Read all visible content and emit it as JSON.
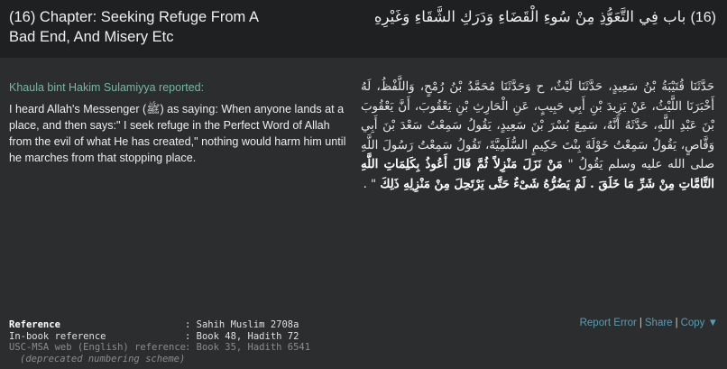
{
  "chapter": {
    "title_en": "(16)  Chapter: Seeking Refuge From A Bad End, And Misery Etc",
    "number_ar": "(16)",
    "title_ar": "باب فِي التَّعَوُّذِ مِنْ سُوءِ الْقَضَاءِ وَدَرَكِ الشَّقَاءِ وَغَيْرِهِ"
  },
  "hadith": {
    "narrator": "Khaula bint Hakim Sulamiyya reported:",
    "english": "I heard Allah's Messenger (ﷺ) as saying: When anyone lands at a place, and then says:\" I seek refuge in the Perfect Word of Allah from the evil of what He has created,\" nothing would harm him until he marches from that stopping place.",
    "arabic_isnad": "حَدَّثَنَا قُتَيْبَةُ بْنُ سَعِيدٍ، حَدَّثَنَا لَيْثٌ، ح وَحَدَّثَنَا مُحَمَّدُ بْنُ رُمْحٍ، وَاللَّفْظُ، لَهُ أَخْبَرَنَا اللَّيْثُ، عَنْ يَزِيدَ بْنِ أَبِي حَبِيبٍ، عَنِ الْحَارِثِ بْنِ يَعْقُوبَ، أَنَّ يَعْقُوبَ بْنَ عَبْدِ اللَّهِ، حَدَّثَهُ أَنَّهُ، سَمِعَ بُسْرَ بْنَ سَعِيدٍ، يَقُولُ سَمِعْتُ سَعْدَ بْنَ أَبِي وَقَّاصٍ، يَقُولُ سَمِعْتُ خَوْلَةَ بِنْتَ حَكِيمٍ السُّلَمِيَّةَ، تَقُولُ سَمِعْتُ رَسُولَ اللَّهِ صلى الله عليه وسلم يَقُولُ \"",
    "arabic_matn": "مَنْ نَزَلَ مَنْزِلاً ثُمَّ قَالَ أَعُوذُ بِكَلِمَاتِ اللَّهِ التَّامَّاتِ مِنْ شَرِّ مَا خَلَقَ . لَمْ يَضُرُّهُ شَىْءٌ حَتَّى يَرْتَحِلَ مِنْ مَنْزِلِهِ ذَلِكَ",
    "arabic_end": "\" ."
  },
  "references": [
    {
      "key": "Reference",
      "value": ": Sahih Muslim 2708a",
      "style": "bold"
    },
    {
      "key": "In-book reference",
      "value": ": Book 48, Hadith 72",
      "style": "plain"
    },
    {
      "key": "USC-MSA web (English) reference",
      "value": ": Book 35, Hadith 6541",
      "style": "dim"
    }
  ],
  "deprecated_note": "(deprecated numbering scheme)",
  "actions": {
    "report": "Report Error",
    "share": "Share",
    "copy": "Copy ▼",
    "separator": "|"
  }
}
